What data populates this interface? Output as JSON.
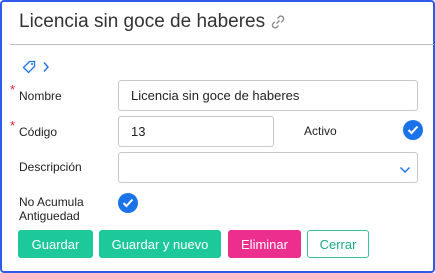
{
  "header": {
    "title": "Licencia sin goce de haberes",
    "link_icon": "link-icon"
  },
  "toolbar": {
    "tag_icon": "tag-icon",
    "chevron_icon": "chevron-right-icon"
  },
  "form": {
    "required_marker": "*",
    "nombre": {
      "label": "Nombre",
      "value": "Licencia sin goce de haberes"
    },
    "codigo": {
      "label": "Código",
      "value": "13"
    },
    "activo": {
      "label": "Activo",
      "checked": true
    },
    "descripcion": {
      "label": "Descripción",
      "value": ""
    },
    "no_acumula": {
      "label_line1": "No Acumula",
      "label_line2": "Antiguedad",
      "checked": true
    }
  },
  "buttons": {
    "guardar": "Guardar",
    "guardar_nuevo": "Guardar y nuevo",
    "eliminar": "Eliminar",
    "cerrar": "Cerrar"
  },
  "colors": {
    "frame": "#2f5bea",
    "primary": "#1dc99a",
    "danger": "#ec2e8e",
    "check": "#1a73e8",
    "required": "#e0203a"
  }
}
